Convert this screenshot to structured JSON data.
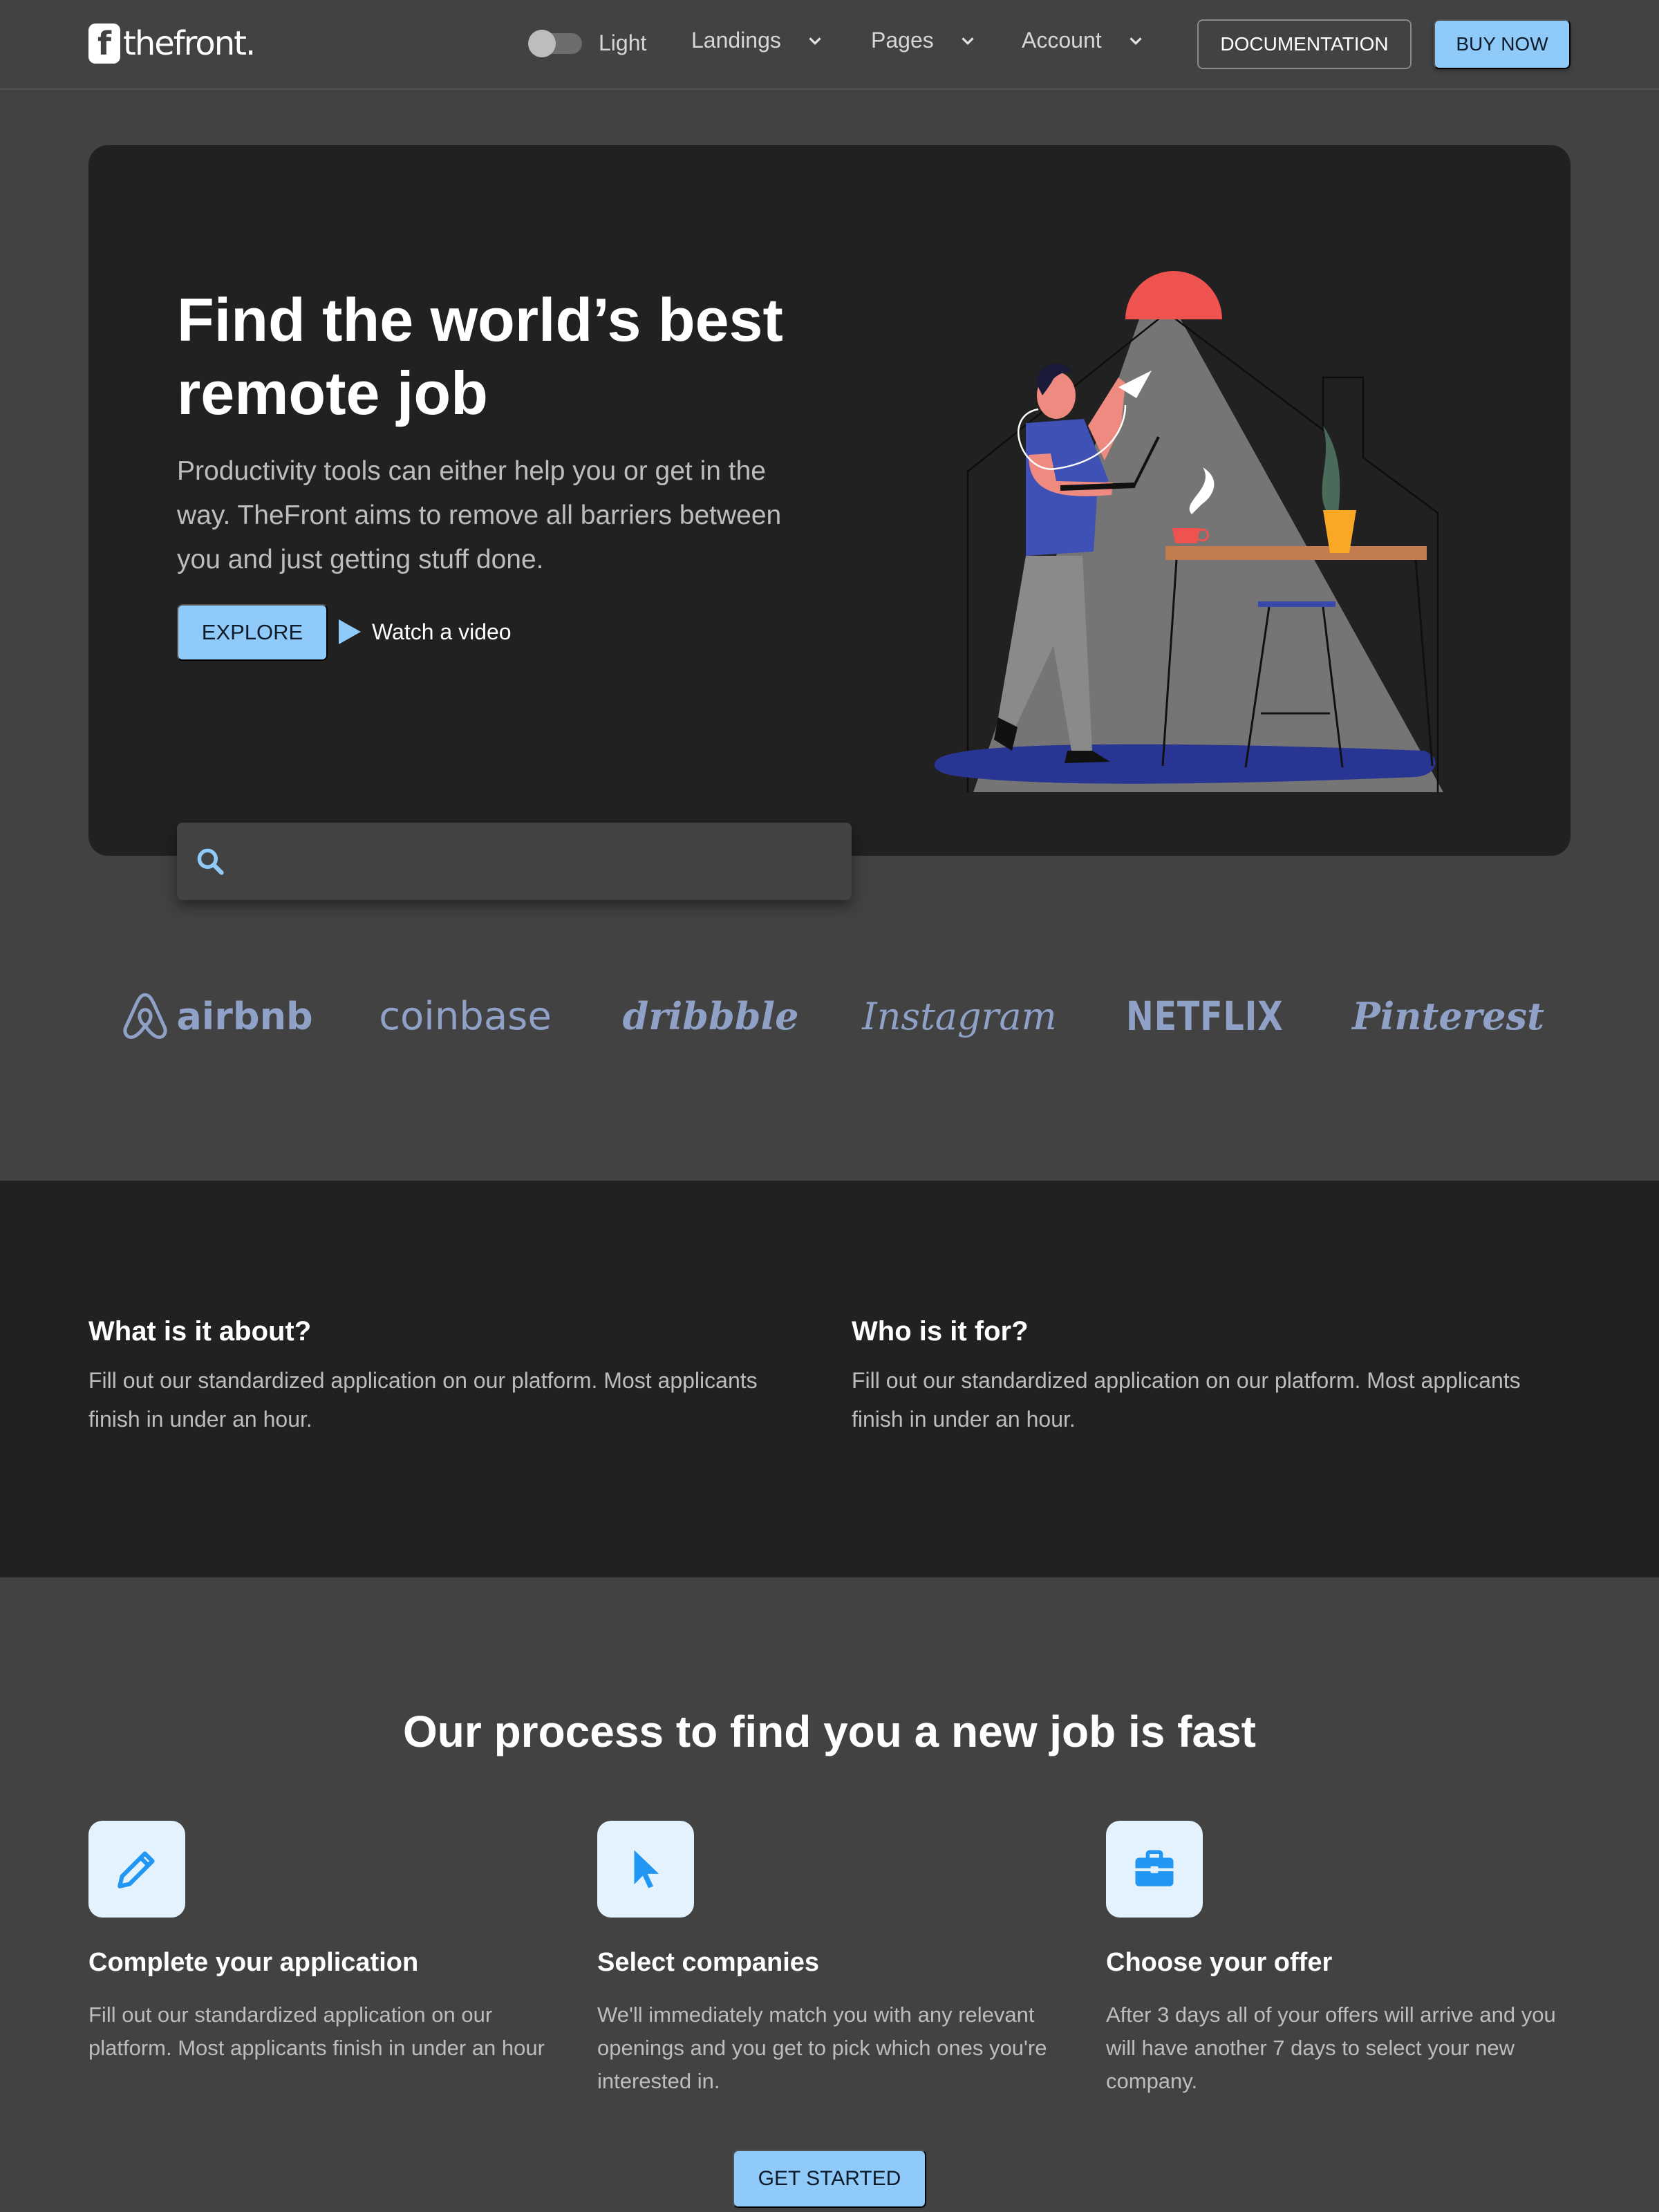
{
  "header": {
    "logo_mark": "f",
    "logo_text": "thefront.",
    "theme_label": "Light",
    "nav": [
      {
        "label": "Landings"
      },
      {
        "label": "Pages"
      },
      {
        "label": "Account"
      }
    ],
    "documentation_label": "DOCUMENTATION",
    "buy_label": "BUY NOW"
  },
  "hero": {
    "title": "Find the world’s best remote job",
    "subtitle": "Productivity tools can either help you or get in the way. TheFront aims to remove all barriers between you and just getting stuff done.",
    "explore_label": "EXPLORE",
    "watch_label": "Watch a video",
    "search": {
      "value": "",
      "placeholder": ""
    }
  },
  "logos": [
    {
      "name": "airbnb"
    },
    {
      "name": "coinbase"
    },
    {
      "name": "dribbble"
    },
    {
      "name": "Instagram"
    },
    {
      "name": "NETFLIX"
    },
    {
      "name": "Pinterest"
    }
  ],
  "about": [
    {
      "title": "What is it about?",
      "text": "Fill out our standardized application on our platform. Most applicants finish in under an hour."
    },
    {
      "title": "Who is it for?",
      "text": "Fill out our standardized application on our platform. Most applicants finish in under an hour."
    }
  ],
  "process": {
    "title": "Our process to find you a new job is fast",
    "steps": [
      {
        "icon": "pencil-icon",
        "title": "Complete your application",
        "text": "Fill out our standardized application on our platform. Most applicants finish in under an hour"
      },
      {
        "icon": "cursor-icon",
        "title": "Select companies",
        "text": "We'll immediately match you with any relevant openings and you get to pick which ones you're interested in."
      },
      {
        "icon": "briefcase-icon",
        "title": "Choose your offer",
        "text": "After 3 days all of your offers will arrive and you will have another 7 days to select your new company."
      }
    ],
    "cta_label": "GET STARTED"
  },
  "colors": {
    "page_bg": "#424242",
    "card_bg": "#212121",
    "accent": "#90caf9",
    "icon_blue": "#2196f3",
    "logo_tint": "#8fa1c7",
    "muted_text": "#bdbdbd"
  }
}
